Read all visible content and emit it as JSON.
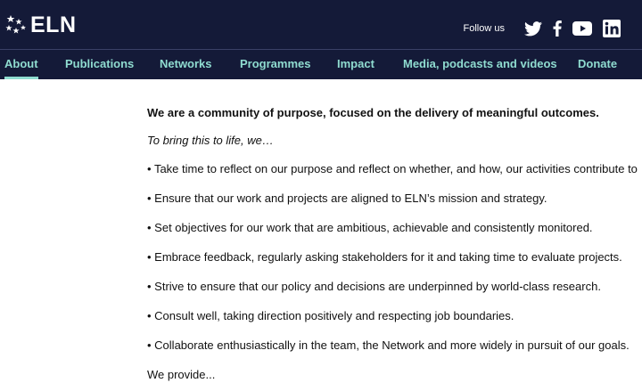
{
  "brand": {
    "name": "ELN",
    "logo_icon": "star-cluster-icon"
  },
  "header": {
    "follow_label": "Follow us",
    "social": [
      {
        "name": "twitter",
        "icon": "twitter-icon"
      },
      {
        "name": "facebook",
        "icon": "facebook-icon"
      },
      {
        "name": "youtube",
        "icon": "youtube-icon"
      },
      {
        "name": "linkedin",
        "icon": "linkedin-icon"
      }
    ]
  },
  "nav": {
    "active": "About",
    "items": [
      {
        "label": "About"
      },
      {
        "label": "Publications"
      },
      {
        "label": "Networks"
      },
      {
        "label": "Programmes"
      },
      {
        "label": "Impact"
      },
      {
        "label": "Media, podcasts and videos"
      },
      {
        "label": "Donate"
      }
    ]
  },
  "content": {
    "lead": "We are a community of purpose, focused on the delivery of meaningful outcomes.",
    "intro": "To bring this to life, we…",
    "bullets": [
      "Take time to reflect on our purpose and reflect on whether, and how, our activities contribute to",
      "Ensure that our work and projects are aligned to ELN’s mission and strategy.",
      "Set objectives for our work that are ambitious, achievable and consistently monitored.",
      "Embrace feedback, regularly asking stakeholders for it and taking time to evaluate projects.",
      "Strive to ensure that our policy and decisions are underpinned by world-class research.",
      "Consult well, taking direction positively and respecting job boundaries.",
      "Collaborate enthusiastically in the team, the Network and more widely in pursuit of our goals."
    ],
    "trailing": "We provide..."
  },
  "colors": {
    "header_bg": "#141a38",
    "nav_text": "#8fdcd0",
    "body_text": "#111111",
    "background": "#ffffff"
  }
}
